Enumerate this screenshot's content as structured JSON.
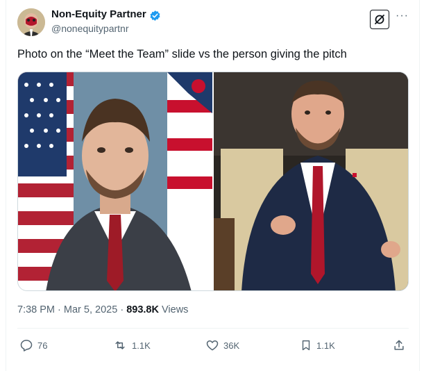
{
  "author": {
    "display_name": "Non-Equity Partner",
    "handle": "@nonequitypartnr"
  },
  "tweet": {
    "text": "Photo on the “Meet the Team” slide vs the person giving the pitch"
  },
  "meta": {
    "time": "7:38 PM",
    "sep1": "·",
    "date": "Mar 5, 2025",
    "sep2": "·",
    "views_count": "893.8K",
    "views_label": "Views"
  },
  "actions": {
    "replies": "76",
    "reposts": "1.1K",
    "likes": "36K",
    "bookmarks": "1.1K"
  },
  "colors": {
    "verified": "#1d9bf0",
    "muted": "#536471",
    "text": "#0f1419"
  }
}
